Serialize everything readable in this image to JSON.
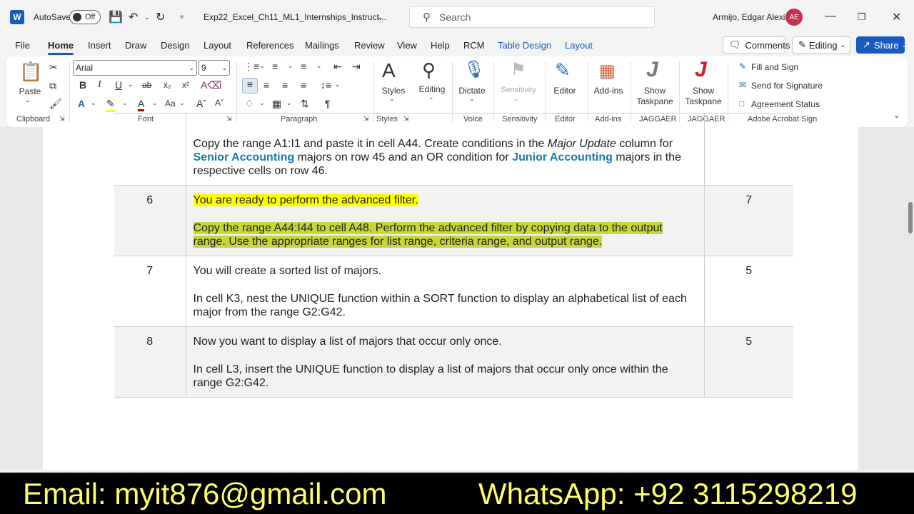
{
  "titlebar": {
    "autosave_label": "AutoSave",
    "autosave_state": "Off",
    "doc_title": "Exp22_Excel_Ch11_ML1_Internships_Instruct...",
    "search_placeholder": "Search",
    "user_name": "Armijo, Edgar Alexis",
    "user_initials": "AE"
  },
  "menu": {
    "items": [
      "File",
      "Home",
      "Insert",
      "Draw",
      "Design",
      "Layout",
      "References",
      "Mailings",
      "Review",
      "View",
      "Help",
      "RCM",
      "Table Design",
      "Layout"
    ],
    "comments": "Comments",
    "editing": "Editing",
    "share": "Share"
  },
  "ribbon": {
    "clipboard": {
      "paste": "Paste",
      "label": "Clipboard"
    },
    "font": {
      "name": "Arial",
      "size": "9",
      "label": "Font"
    },
    "paragraph": {
      "label": "Paragraph"
    },
    "styles": {
      "btn": "Styles",
      "label": "Styles"
    },
    "editing": {
      "btn": "Editing"
    },
    "voice": {
      "btn": "Dictate",
      "label": "Voice"
    },
    "sensitivity": {
      "btn": "Sensitivity",
      "label": "Sensitivity"
    },
    "editor": {
      "btn": "Editor",
      "label": "Editor"
    },
    "addins": {
      "btn": "Add-ins",
      "label": "Add-ins"
    },
    "jaggaer1": {
      "line1": "Show",
      "line2": "Taskpane",
      "label": "JAGGAER"
    },
    "jaggaer2": {
      "line1": "Show",
      "line2": "Taskpane",
      "label": "JAGGAER"
    },
    "acrobat": {
      "fill": "Fill and Sign",
      "send": "Send for Signature",
      "status": "Agreement Status",
      "label": "Adobe Acrobat Sign"
    }
  },
  "document": {
    "rows": [
      {
        "num": "",
        "pts": "",
        "p1_a": "Copy the range A1:I1 and paste it in cell A44. Create conditions in the ",
        "p1_em": "Major Update",
        "p1_b": " column for ",
        "p1_sa": "Senior Accounting",
        "p1_c": " majors on row 45 and an OR condition for ",
        "p1_ja": "Junior Accounting",
        "p1_d": " majors in the respective cells on row 46."
      },
      {
        "num": "6",
        "pts": "7",
        "p1": "You are ready to perform the advanced filter.",
        "p2": "Copy the range A44:I44 to cell A48. Perform the advanced filter by copying data to the output range. Use the appropriate ranges for list range, criteria range, and output range."
      },
      {
        "num": "7",
        "pts": "5",
        "p1": "You will create a sorted list of majors.",
        "p2": "In cell K3, nest the UNIQUE function within a SORT function to display an alphabetical list of each major from the range G2:G42."
      },
      {
        "num": "8",
        "pts": "5",
        "p1": "Now you want to display a list of majors that occur only once.",
        "p2": "In cell L3, insert the UNIQUE function to display a list of majors that occur only once within the range G2:G42."
      }
    ]
  },
  "banner": {
    "email": "Email: myit876@gmail.com",
    "whatsapp": "WhatsApp:  +92 3115298219"
  }
}
